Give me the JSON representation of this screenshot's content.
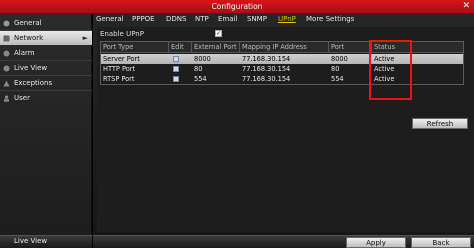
{
  "window": {
    "title": "Configuration",
    "close_glyph": "✕"
  },
  "sidebar": {
    "items": [
      {
        "label": "General",
        "icon": "general-icon"
      },
      {
        "label": "Network",
        "icon": "network-icon",
        "active": true
      },
      {
        "label": "Alarm",
        "icon": "alarm-icon"
      },
      {
        "label": "Live View",
        "icon": "live-view-icon"
      },
      {
        "label": "Exceptions",
        "icon": "exceptions-icon"
      },
      {
        "label": "User",
        "icon": "user-icon"
      }
    ],
    "bottom_label": "Live View"
  },
  "tabs": [
    "General",
    "PPPOE",
    "DDNS",
    "NTP",
    "Email",
    "SNMP",
    "UPnP",
    "More Settings"
  ],
  "active_tab": "UPnP",
  "upnp": {
    "label": "Enable UPnP",
    "checked": true,
    "check_glyph": "✓"
  },
  "table": {
    "headers": [
      "Port Type",
      "Edit",
      "External Port",
      "Mapping IP Address",
      "Port",
      "Status"
    ],
    "rows": [
      {
        "type": "Server Port",
        "external_port": "8000",
        "ip": "77.168.30.154",
        "port": "8000",
        "status": "Active",
        "selected": true
      },
      {
        "type": "HTTP Port",
        "external_port": "80",
        "ip": "77.168.30.154",
        "port": "80",
        "status": "Active"
      },
      {
        "type": "RTSP Port",
        "external_port": "554",
        "ip": "77.168.30.154",
        "port": "554",
        "status": "Active"
      }
    ]
  },
  "buttons": {
    "refresh": "Refresh",
    "apply": "Apply",
    "back": "Back"
  },
  "colors": {
    "title_bar": "#c8101a",
    "active_tab": "#e0c000",
    "highlight_box": "#e01818"
  }
}
